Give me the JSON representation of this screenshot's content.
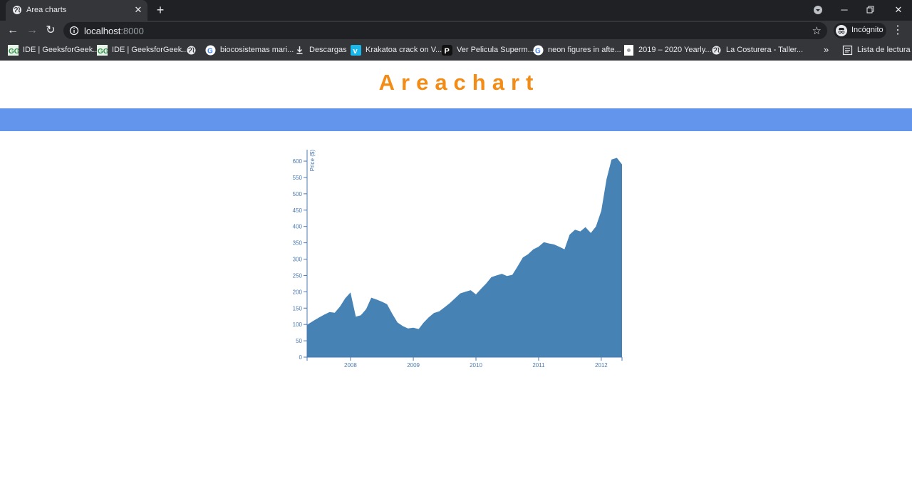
{
  "browser": {
    "tab_title": "Area charts",
    "new_tab_icon": "plus-icon",
    "url_host": "localhost",
    "url_port": ":8000",
    "profile_label": "Incógnito",
    "bookmarks": [
      {
        "label": "IDE | GeeksforGeek...",
        "icon": "gfg-icon"
      },
      {
        "label": "IDE | GeeksforGeek...",
        "icon": "gfg-icon"
      },
      {
        "label": "",
        "icon": "globe-icon"
      },
      {
        "label": "biocosistemas mari...",
        "icon": "google-icon"
      },
      {
        "label": "Descargas",
        "icon": "download-icon"
      },
      {
        "label": "Krakatoa crack on V...",
        "icon": "vimeo-icon"
      },
      {
        "label": "Ver Pelicula Superm...",
        "icon": "p-icon"
      },
      {
        "label": "neon figures in afte...",
        "icon": "google-icon"
      },
      {
        "label": "2019 – 2020 Yearly...",
        "icon": "doc-icon"
      },
      {
        "label": "La Costurera - Taller...",
        "icon": "globe-icon"
      }
    ],
    "bookmarks_overflow": "»",
    "reading_list_label": "Lista de lectura"
  },
  "page": {
    "heading": "Areachart",
    "band_color": "#6495ed",
    "heading_color": "#f28c16"
  },
  "chart_data": {
    "type": "area",
    "title": "",
    "xlabel": "",
    "ylabel": "Price ($)",
    "color": "#4682b4",
    "x_ticks": [
      "2008",
      "2009",
      "2010",
      "2011",
      "2012"
    ],
    "y_ticks": [
      0,
      50,
      100,
      150,
      200,
      250,
      300,
      350,
      400,
      450,
      500,
      550,
      600
    ],
    "xlim": [
      "2007-04-23",
      "2012-05-01"
    ],
    "ylim": [
      0,
      635
    ],
    "x": [
      "2007-04-23",
      "2007-06-01",
      "2007-07-01",
      "2007-08-01",
      "2007-09-01",
      "2007-10-01",
      "2007-11-01",
      "2007-12-01",
      "2008-01-01",
      "2008-02-01",
      "2008-03-01",
      "2008-04-01",
      "2008-05-01",
      "2008-06-01",
      "2008-07-01",
      "2008-08-01",
      "2008-09-01",
      "2008-10-01",
      "2008-11-01",
      "2008-12-01",
      "2009-01-01",
      "2009-02-01",
      "2009-03-01",
      "2009-04-01",
      "2009-05-01",
      "2009-06-01",
      "2009-07-01",
      "2009-08-01",
      "2009-09-01",
      "2009-10-01",
      "2009-11-01",
      "2009-12-01",
      "2010-01-01",
      "2010-02-01",
      "2010-03-01",
      "2010-04-01",
      "2010-05-01",
      "2010-06-01",
      "2010-07-01",
      "2010-08-01",
      "2010-09-01",
      "2010-10-01",
      "2010-11-01",
      "2010-12-01",
      "2011-01-01",
      "2011-02-01",
      "2011-03-01",
      "2011-04-01",
      "2011-05-01",
      "2011-06-01",
      "2011-07-01",
      "2011-08-01",
      "2011-09-01",
      "2011-10-01",
      "2011-11-01",
      "2011-12-01",
      "2012-01-01",
      "2012-02-01",
      "2012-03-01",
      "2012-04-01",
      "2012-05-01"
    ],
    "values": [
      99,
      112,
      121,
      130,
      138,
      136,
      155,
      180,
      198,
      124,
      128,
      147,
      182,
      176,
      170,
      162,
      132,
      106,
      95,
      88,
      90,
      86,
      105,
      122,
      135,
      140,
      152,
      165,
      180,
      195,
      200,
      205,
      192,
      210,
      225,
      245,
      250,
      255,
      248,
      252,
      278,
      305,
      315,
      330,
      338,
      352,
      348,
      345,
      338,
      330,
      375,
      390,
      385,
      398,
      380,
      400,
      448,
      545,
      605,
      610,
      590
    ]
  }
}
